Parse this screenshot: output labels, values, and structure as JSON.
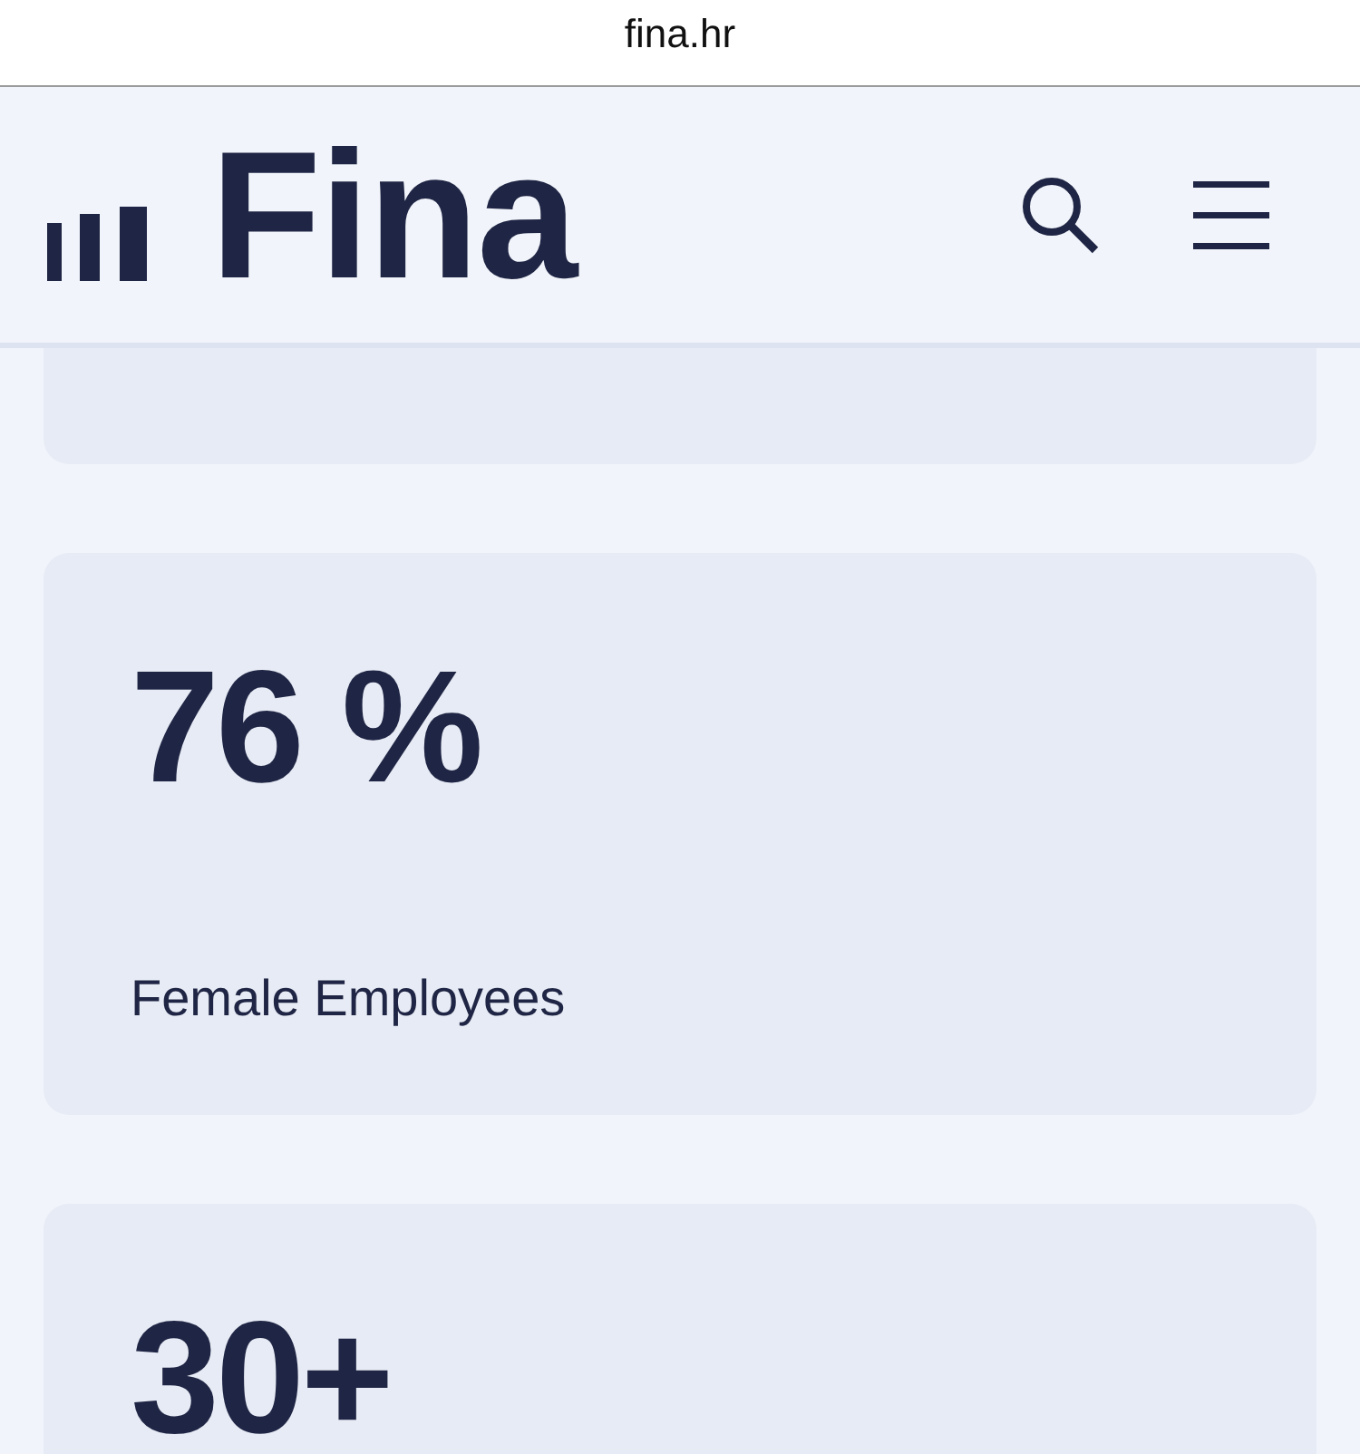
{
  "browser": {
    "address": "fina.hr"
  },
  "header": {
    "logo": "Fina"
  },
  "stats": [
    {
      "value": "76 %",
      "label": "Female Employees"
    },
    {
      "value": "30+"
    }
  ]
}
